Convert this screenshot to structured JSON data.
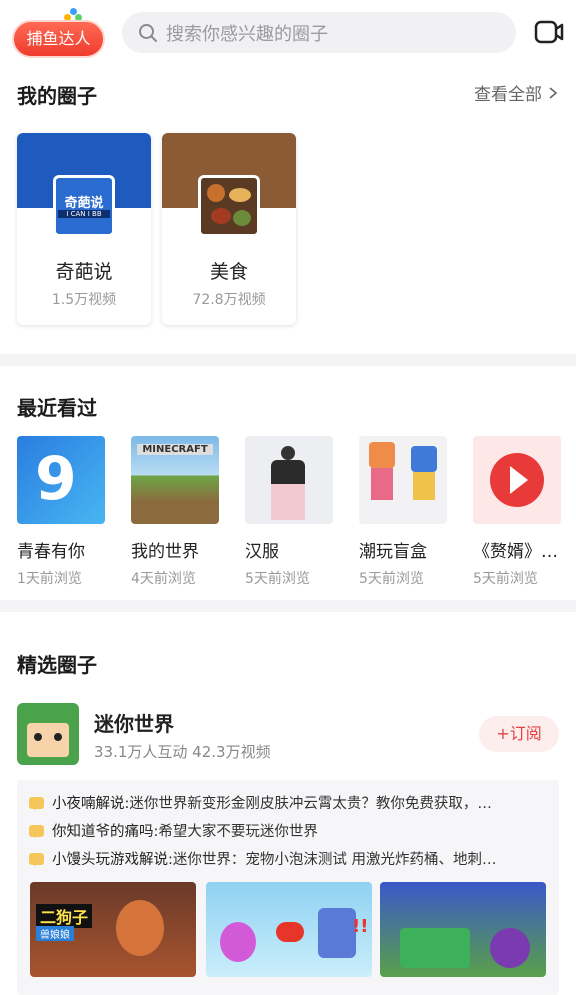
{
  "top": {
    "brand_label": "捕鱼达人",
    "search_placeholder": "搜索你感兴趣的圈子"
  },
  "my_circles": {
    "title": "我的圈子",
    "see_all": "查看全部",
    "items": [
      {
        "name": "奇葩说",
        "count": "1.5万视频",
        "logo_text": "奇葩说",
        "logo_sub": "I CAN I BB"
      },
      {
        "name": "美食",
        "count": "72.8万视频"
      }
    ]
  },
  "recent": {
    "title": "最近看过",
    "items": [
      {
        "name": "青春有你",
        "time": "1天前浏览"
      },
      {
        "name": "我的世界",
        "time": "4天前浏览",
        "thumb_text": "MINECRAFT"
      },
      {
        "name": "汉服",
        "time": "5天前浏览"
      },
      {
        "name": "潮玩盲盒",
        "time": "5天前浏览"
      },
      {
        "name": "《赘婿》…",
        "time": "5天前浏览"
      }
    ]
  },
  "featured": {
    "title": "精选圈子",
    "name": "迷你世界",
    "stats": "33.1万人互动 42.3万视频",
    "subscribe": "订阅",
    "posts": [
      {
        "author": "小夜喃解说:",
        "text": " 迷你世界新变形金刚皮肤冲云霄太贵？教你免费获取，…"
      },
      {
        "author": "你知道爷的痛吗:",
        "text": " 希望大家不要玩迷你世界"
      },
      {
        "author": "小馒头玩游戏解说:",
        "text": " 迷你世界：宠物小泡沫测试 用激光炸药桶、地刺…"
      }
    ],
    "video_text": [
      "二狗子",
      "兽娘娘"
    ]
  },
  "colors": {
    "accent": "#ef3b2d",
    "qipa_blue": "#1f5bbf",
    "food_brown": "#8a5b34"
  }
}
